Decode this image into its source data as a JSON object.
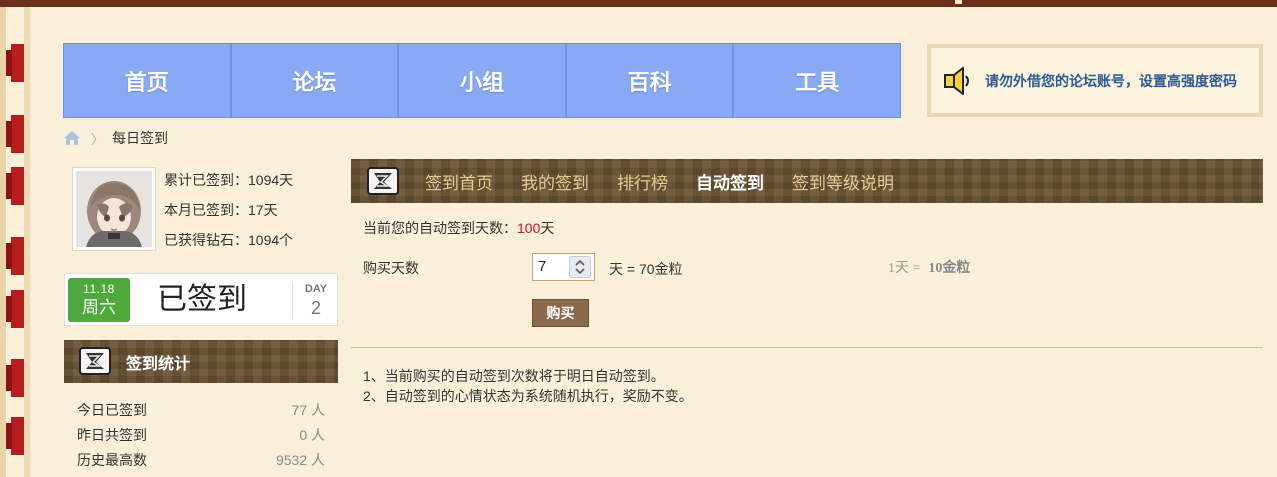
{
  "nav": {
    "items": [
      "首页",
      "论坛",
      "小组",
      "百科",
      "工具"
    ]
  },
  "notice": {
    "text": "请勿外借您的论坛账号，设置高强度密码",
    "icon": "speaker-icon"
  },
  "breadcrumb": {
    "current": "每日签到",
    "icon": "home-icon"
  },
  "user": {
    "total_signed": "累计已签到：1094天",
    "month_signed": "本月已签到：17天",
    "diamonds": "已获得钻石：1094个"
  },
  "sign_badge": {
    "date": "11.18",
    "weekday": "周六",
    "status": "已签到",
    "day_label": "DAY",
    "day_count": "2"
  },
  "side_stats": {
    "title": "签到统计",
    "rows": [
      {
        "label": "今日已签到",
        "value": "77 人"
      },
      {
        "label": "昨日共签到",
        "value": "0 人"
      },
      {
        "label": "历史最高数",
        "value": "9532 人"
      }
    ]
  },
  "tabs": {
    "items": [
      "签到首页",
      "我的签到",
      "排行榜",
      "自动签到",
      "签到等级说明"
    ],
    "active_index": 3
  },
  "auto_sign": {
    "days_prefix": "当前您的自动签到天数：",
    "days_value": "100",
    "days_suffix": "天",
    "buy_label": "购买天数",
    "quantity": "7",
    "price_text": "天 = 70金粒",
    "unit_price_prefix": "1天 =",
    "unit_price_value": "10金粒",
    "buy_button": "购买"
  },
  "notes": [
    "1、当前购买的自动签到次数将于明日自动签到。",
    "2、自动签到的心情状态为系统随机执行，奖励不变。"
  ],
  "colors": {
    "nav_bg": "#88aaf5",
    "brown_bar": "#6a5334",
    "accent_red": "#d6141e",
    "badge_green": "#4ea83b",
    "notice_text": "#2c5b96"
  }
}
